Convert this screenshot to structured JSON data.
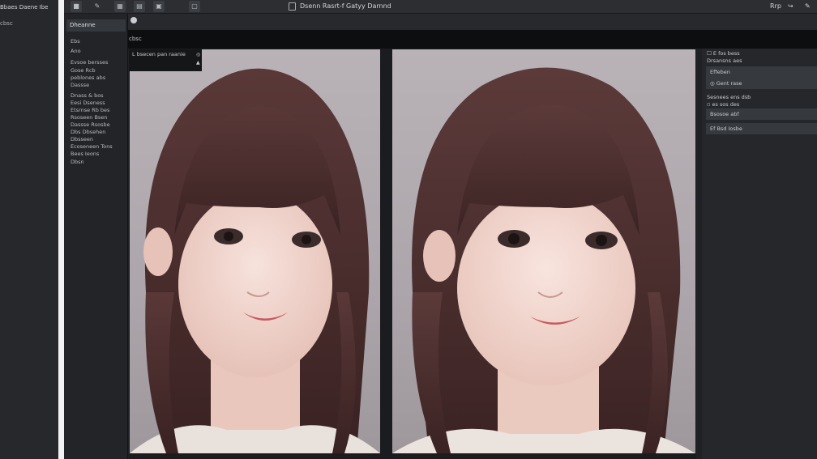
{
  "left_strip": {
    "menu": "Bbaes  Daene  Ibe",
    "sub": "cbsc"
  },
  "toolbar": {
    "title": "Dsenn  Rasrt-f  Gatyy  Darnnd",
    "right_items": [
      "Rrp",
      "↪",
      "✎"
    ]
  },
  "strip3_label": "cbsc",
  "sidebar": {
    "header": "Dheanne",
    "items": [
      "Ebs",
      "Ano",
      "Evsoe  bersses",
      "Gose  Rcb",
      "peblones  abs",
      "Dassse",
      "Dnass    &    bos",
      "Eesi  Dseness",
      "Etsrnse  Rb  bes",
      "Rsoseen  Bsen",
      "Dassse  Rsosbe",
      "Dbs  Dbsehen",
      "Dbsseen",
      "Ecoseneen  Tons",
      "Bees  Ieons",
      "Dbsn"
    ]
  },
  "image_tag": {
    "text": "L bsecen  pan  raanie",
    "icon1": "◎",
    "icon2": "▲"
  },
  "right_panel": {
    "label1": "☐  E  fos  bess",
    "label2": "Drsansns  aes",
    "field1": "Effeben",
    "field2": "◎  Gent  rase",
    "label3": "Sesnees  ens  dsb",
    "label4": "▫  es  sos  des",
    "field3": "Bsosoe  abf",
    "field4": "Ef  Bsd  Iosbe"
  },
  "colors": {
    "background": "#1f2124",
    "panel": "#25272b",
    "hair": "#4a2e2e",
    "skin": "#f0d6cf"
  }
}
